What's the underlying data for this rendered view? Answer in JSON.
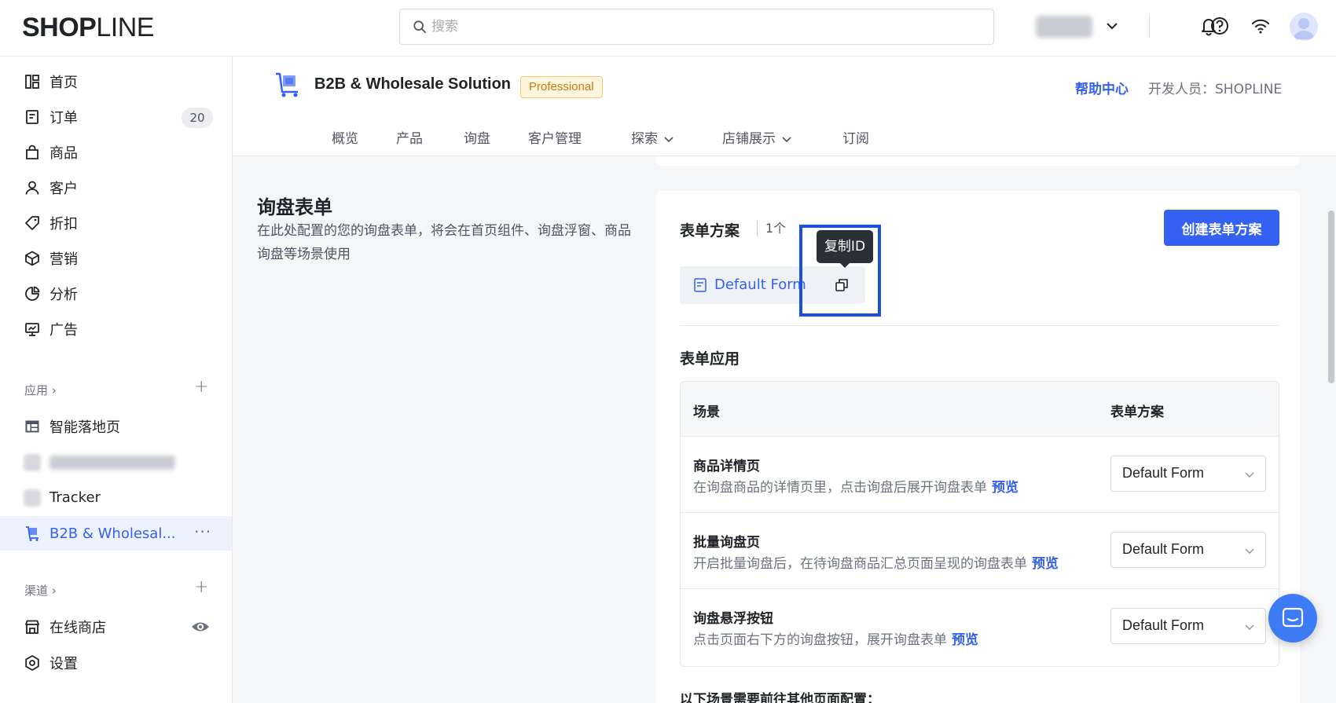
{
  "topbar": {
    "logo_bold": "SHOP",
    "logo_thin": "LINE",
    "search_placeholder": "搜索"
  },
  "sidebar": {
    "items": [
      {
        "label": "首页",
        "icon": "dashboard-icon"
      },
      {
        "label": "订单",
        "icon": "order-icon",
        "badge": "20"
      },
      {
        "label": "商品",
        "icon": "bag-icon"
      },
      {
        "label": "客户",
        "icon": "user-icon"
      },
      {
        "label": "折扣",
        "icon": "tag-icon"
      },
      {
        "label": "营销",
        "icon": "cube-icon"
      },
      {
        "label": "分析",
        "icon": "pie-icon"
      },
      {
        "label": "广告",
        "icon": "ad-icon"
      }
    ],
    "apps_title": "应用",
    "apps": [
      {
        "label": "智能落地页"
      },
      {
        "label": "Tracker"
      },
      {
        "label": "B2B & Wholesal..."
      }
    ],
    "channels_title": "渠道",
    "online_store": "在线商店",
    "settings": "设置"
  },
  "app": {
    "title": "B2B & Wholesale Solution",
    "plan_tag": "Professional",
    "help_link": "帮助中心",
    "developer": "开发人员：SHOPLINE",
    "tabs": [
      "概览",
      "产品",
      "询盘",
      "客户管理",
      "探索",
      "店铺展示",
      "订阅"
    ]
  },
  "section": {
    "title": "询盘表单",
    "description": "在此处配置的您的询盘表单，将会在首页组件、询盘浮窗、商品询盘等场景使用"
  },
  "form_schemes": {
    "title": "表单方案",
    "count": "1个",
    "create_button": "创建表单方案",
    "default_form": "Default Form",
    "tooltip": "复制ID"
  },
  "form_application": {
    "title": "表单应用",
    "headers": [
      "场景",
      "表单方案"
    ],
    "rows": [
      {
        "name": "商品详情页",
        "desc": "在询盘商品的详情页里，点击询盘后展开询盘表单",
        "link": "预览",
        "value": "Default Form"
      },
      {
        "name": "批量询盘页",
        "desc": "开启批量询盘后，在待询盘商品汇总页面呈现的询盘表单",
        "link": "预览",
        "value": "Default Form"
      },
      {
        "name": "询盘悬浮按钮",
        "desc": "点击页面右下方的询盘按钮，展开询盘表单",
        "link": "预览",
        "value": "Default Form"
      }
    ],
    "footer_note": "以下场景需要前往其他页面配置："
  },
  "colors": {
    "accent": "#3461f2",
    "highlight": "#1a4fe0",
    "tag_bg": "#fff4dc",
    "tag_text": "#c97a12"
  }
}
